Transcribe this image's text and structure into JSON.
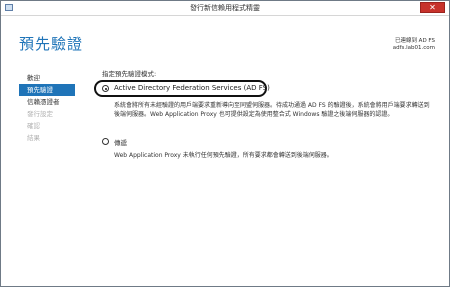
{
  "window": {
    "title": "發行新信賴用程式精靈",
    "close_glyph": "✕"
  },
  "header": {
    "page_title": "預先驗證",
    "server_label": "已連線到 AD FS",
    "server_name": "adfs.lab01.com"
  },
  "sidebar": {
    "items": [
      {
        "label": "歡迎",
        "state": "normal"
      },
      {
        "label": "預先驗證",
        "state": "active"
      },
      {
        "label": "信賴憑證者",
        "state": "normal"
      },
      {
        "label": "發行設定",
        "state": "disabled"
      },
      {
        "label": "確認",
        "state": "disabled"
      },
      {
        "label": "結果",
        "state": "disabled"
      }
    ]
  },
  "main": {
    "section_label": "指定預先驗證模式:",
    "options": [
      {
        "label": "Active Directory Federation Services (AD FS)",
        "selected": true,
        "description": "系統會將所有未經驗證的用戶端要求重新導向至同盟伺服器。待成功通過 AD FS 的驗證後，系統會將用戶端要求轉送到後端伺服器。Web Application Proxy 也可提供設定為使用整合式 Windows 驗證之後端伺服器的認證。"
      },
      {
        "label": "傳遞",
        "selected": false,
        "description": "Web Application Proxy 未執行任何預先驗證，所有要求都會轉送到後端伺服器。"
      }
    ]
  },
  "colors": {
    "accent": "#1f74b8",
    "close": "#c7322b",
    "highlight_border": "#111111"
  }
}
